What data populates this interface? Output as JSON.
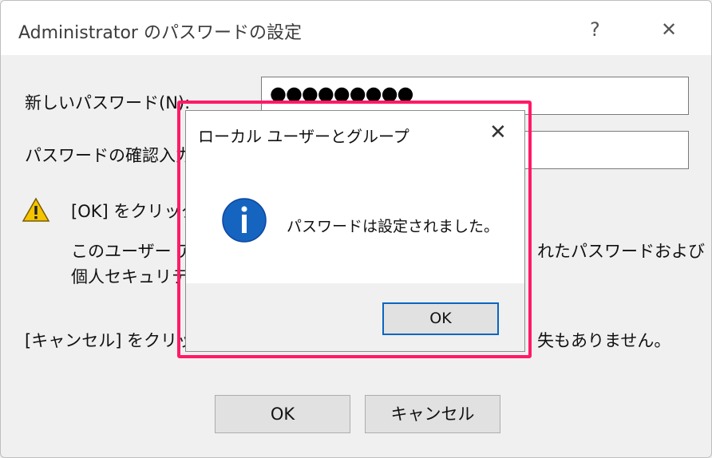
{
  "parent_dialog": {
    "title": "Administrator のパスワードの設定",
    "help_glyph": "?",
    "close_glyph": "✕",
    "new_password_label": "新しいパスワード(N):",
    "new_password_value": "●●●●●●●●●",
    "confirm_password_label": "パスワードの確認入力",
    "warning_line1": "[OK] をクリック",
    "warning_line2_left": "このユーザー ア",
    "warning_line2_right": "れたパスワードおよび",
    "warning_line3_left": "個人セキュリテ",
    "cancel_note_left": "[キャンセル] をクリック",
    "cancel_note_right": "失もありません。",
    "ok_label": "OK",
    "cancel_label": "キャンセル"
  },
  "message_box": {
    "title": "ローカル ユーザーとグループ",
    "close_glyph": "✕",
    "message": "パスワードは設定されました。",
    "ok_label": "OK",
    "icon": "info-icon"
  },
  "colors": {
    "highlight": "#ff1a66",
    "info_blue": "#1565c0",
    "focus_border": "#0a66c2",
    "warning_yellow": "#f5c400"
  }
}
